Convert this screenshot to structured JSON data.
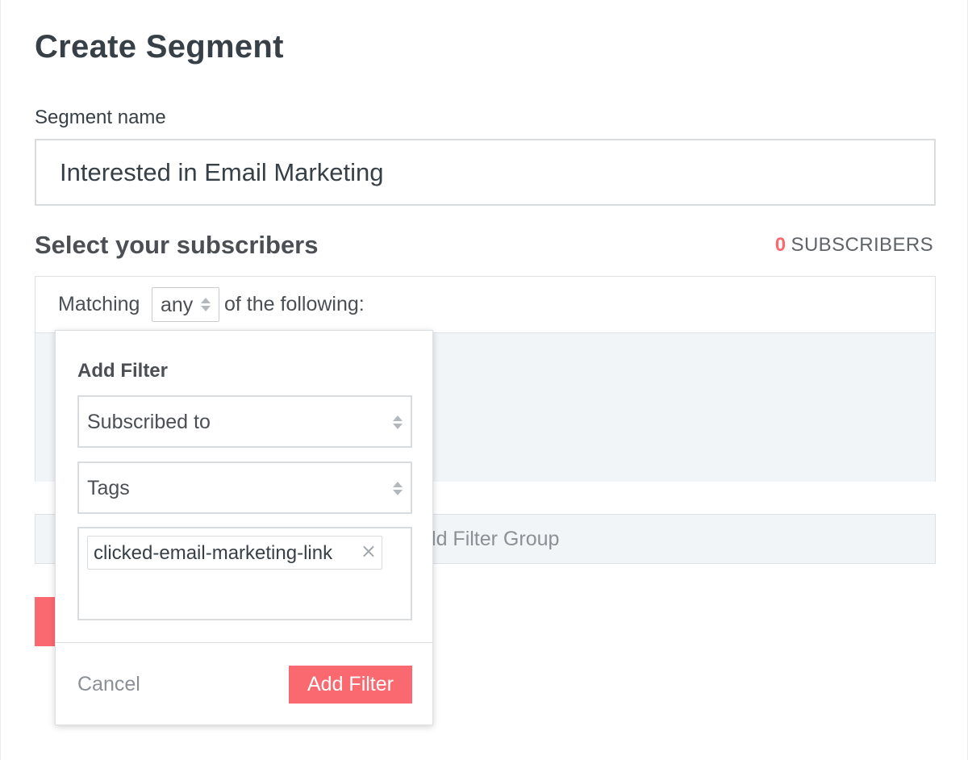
{
  "page": {
    "title": "Create Segment"
  },
  "segment_name": {
    "label": "Segment name",
    "value": "Interested in Email Marketing"
  },
  "subscribers": {
    "section_title": "Select your subscribers",
    "count": "0",
    "count_label": "SUBSCRIBERS"
  },
  "matching": {
    "prefix": "Matching",
    "selected": "any",
    "suffix": "of the following:"
  },
  "filter_group": {
    "label": "Add Filter Group"
  },
  "add_filter_popover": {
    "title": "Add Filter",
    "condition_select": "Subscribed to",
    "type_select": "Tags",
    "tags": [
      {
        "label": "clicked-email-marketing-link",
        "remove_glyph": "×"
      }
    ],
    "cancel_label": "Cancel",
    "submit_label": "Add Filter"
  },
  "colors": {
    "accent": "#fb6970",
    "text": "#373f47",
    "muted": "#8a9096",
    "panel_bg": "#f2f5f8",
    "border": "#dde1e4"
  }
}
